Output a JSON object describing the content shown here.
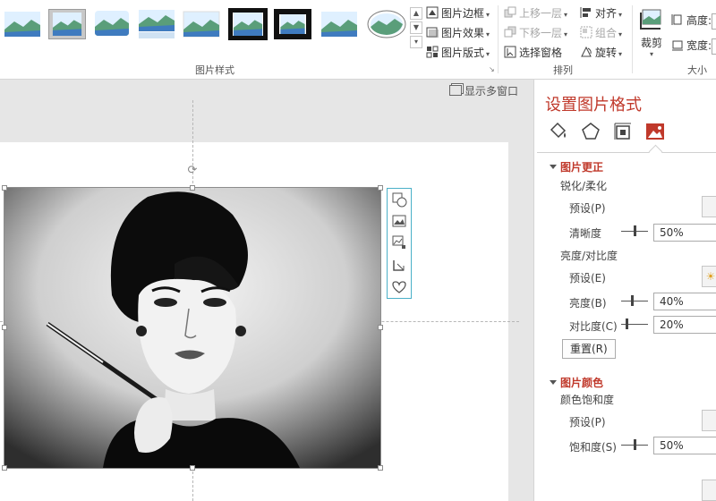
{
  "ribbon": {
    "picture_styles_label": "图片样式",
    "border_label": "图片边框",
    "effects_label": "图片效果",
    "layout_label": "图片版式",
    "bring_forward_label": "上移一层",
    "send_backward_label": "下移一层",
    "selection_pane_label": "选择窗格",
    "align_label": "对齐",
    "group_label": "组合",
    "rotate_label": "旋转",
    "arrange_group_label": "排列",
    "crop_label": "裁剪",
    "height_label": "高度:",
    "width_label": "宽度:",
    "size_group_label": "大小"
  },
  "workspace": {
    "show_multiple_windows": "显示多窗口"
  },
  "pane": {
    "title": "设置图片格式",
    "picture_corrections_title": "图片更正",
    "sharpen_soften_label": "锐化/柔化",
    "sharpen_preset_label": "预设(P)",
    "sharpness_label": "清晰度",
    "sharpness_value": "50%",
    "sharpness_level": 0.5,
    "brightness_contrast_label": "亮度/对比度",
    "brightness_preset_label": "预设(E)",
    "brightness_label": "亮度(B)",
    "brightness_value": "40%",
    "brightness_level": 0.4,
    "contrast_label": "对比度(C)",
    "contrast_value": "20%",
    "contrast_level": 0.2,
    "reset_label": "重置(R)",
    "picture_color_title": "图片颜色",
    "color_saturation_label": "颜色饱和度",
    "saturation_preset_label": "预设(P)",
    "saturation_label": "饱和度(S)",
    "saturation_value": "50%",
    "saturation_level": 0.5
  },
  "colors": {
    "accent": "#c0392b",
    "selection_frame": "#4ab0c8"
  }
}
